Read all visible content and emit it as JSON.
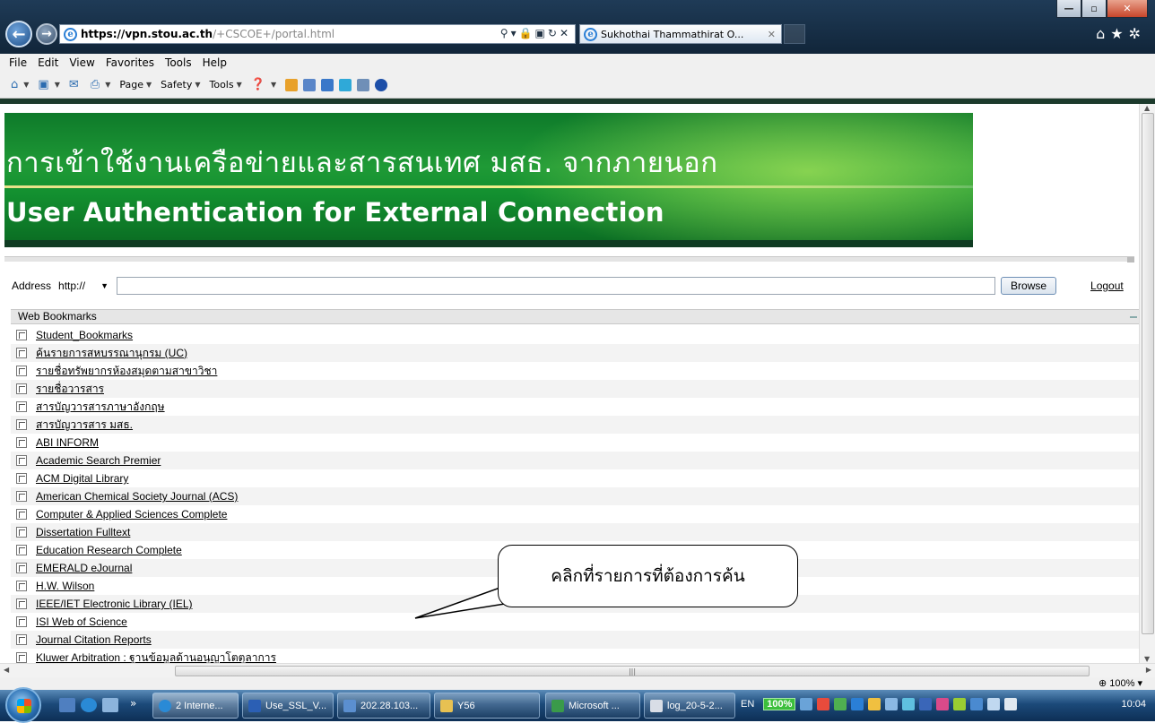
{
  "browser": {
    "url_host": "https://vpn.stou.ac.th",
    "url_path": "/+CSCOE+/portal.html",
    "tab_title": "Sukhothai Thammathirat O...",
    "menu": [
      "File",
      "Edit",
      "View",
      "Favorites",
      "Tools",
      "Help"
    ],
    "command_bar": [
      "Page",
      "Safety",
      "Tools"
    ]
  },
  "banner": {
    "thai_title": "การเข้าใช้งานเครือข่ายและสารสนเทศ มสธ. จากภายนอก",
    "english_title": "User Authentication for External Connection"
  },
  "address_bar": {
    "label": "Address",
    "protocol": "http://",
    "browse_label": "Browse",
    "logout_label": "Logout"
  },
  "bookmarks": {
    "heading": "Web Bookmarks",
    "items": [
      "Student_Bookmarks",
      "ค้นรายการสหบรรณานุกรม (UC)",
      "รายชื่อทรัพยากรห้องสมุดตามสาขาวิชา",
      "รายชื่อวารสาร",
      "สารบัญวารสารภาษาอังกฤษ",
      "สารบัญวารสาร มสธ.",
      "ABI INFORM",
      "Academic Search Premier",
      "ACM Digital Library",
      "American Chemical Society Journal (ACS)",
      "Computer & Applied Sciences Complete",
      "Dissertation Fulltext",
      "Education Research Complete",
      "EMERALD eJournal",
      "H.W. Wilson",
      "IEEE/IET Electronic Library (IEL)",
      "ISI Web of Science",
      "Journal Citation Reports",
      "Kluwer Arbitration : ฐานข้อมูลด้านอนุญาโตตุลาการ"
    ]
  },
  "callout": {
    "text": "คลิกที่รายการที่ต้องการค้น"
  },
  "status": {
    "zoom": "100%"
  },
  "taskbar": {
    "buttons": [
      "2 Interne...",
      "Use_SSL_V...",
      "202.28.103...",
      "Y56",
      "Microsoft ...",
      "log_20-5-2..."
    ],
    "lang": "EN",
    "battery": "100%",
    "time": "10:04"
  }
}
